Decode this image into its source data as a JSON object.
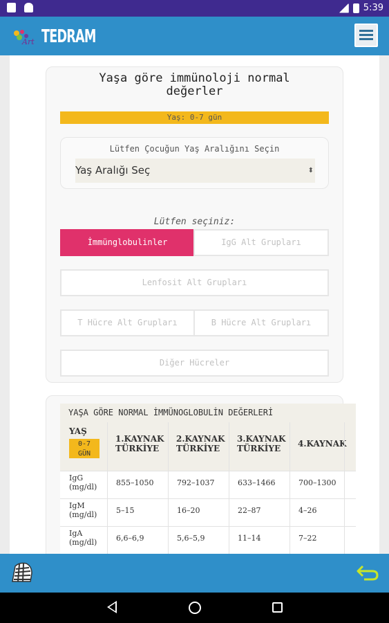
{
  "status_bar": {
    "time": "5:39"
  },
  "app_bar": {
    "logo_text": "TEDRAM"
  },
  "page": {
    "title_line1": "Yaşa göre immünoloji normal",
    "title_line2": "değerler",
    "age_banner": "Yaş: 0-7 gün",
    "select_label": "Lütfen Çocuğun Yaş Aralığını Seçin",
    "select_value": "Yaş Aralığı Seç",
    "prompt": "Lütfen seçiniz:",
    "buttons": {
      "immunoglobulins": "İmmünglobulinler",
      "igg_subgroups": "IgG Alt Grupları",
      "lymphocyte_subgroups": "Lenfosit Alt Grupları",
      "t_cell_subgroups": "T Hücre Alt Grupları",
      "b_cell_subgroups": "B Hücre Alt Grupları",
      "other_cells": "Diğer Hücreler"
    }
  },
  "table": {
    "title": "YAŞA GÖRE NORMAL İMMÜNOGLOBULİN DEĞERLERİ",
    "corner_label": "YAŞ",
    "corner_badge_line1": "0-7",
    "corner_badge_line2": "GÜN",
    "columns": [
      {
        "line1": "1.KAYNAK",
        "line2": "TÜRKİYE"
      },
      {
        "line1": "2.KAYNAK",
        "line2": "TÜRKİYE"
      },
      {
        "line1": "3.KAYNAK",
        "line2": "TÜRKİYE"
      },
      {
        "line1": "4.KAYNAK",
        "line2": ""
      }
    ],
    "rows": [
      {
        "label1": "IgG",
        "label2": "(mg/dl)",
        "values": [
          "855–1050",
          "792–1037",
          "633–1466",
          "700–1300"
        ]
      },
      {
        "label1": "IgM",
        "label2": "(mg/dl)",
        "values": [
          "5–15",
          "16–20",
          "22–87",
          "4–26"
        ]
      },
      {
        "label1": "IgA",
        "label2": "(mg/dl)",
        "values": [
          "6,6–6,9",
          "5,6–5,9",
          "11–14",
          "7–22"
        ]
      }
    ]
  },
  "colors": {
    "status_bar": "#3f2a8f",
    "app_bar": "#2f8fc9",
    "accent_pink": "#e0316b",
    "accent_yellow": "#f3b81c"
  },
  "icons": {
    "menu": "hamburger-menu-icon",
    "bottom_left": "zebra-icon",
    "bottom_right": "back-arrow-icon"
  }
}
